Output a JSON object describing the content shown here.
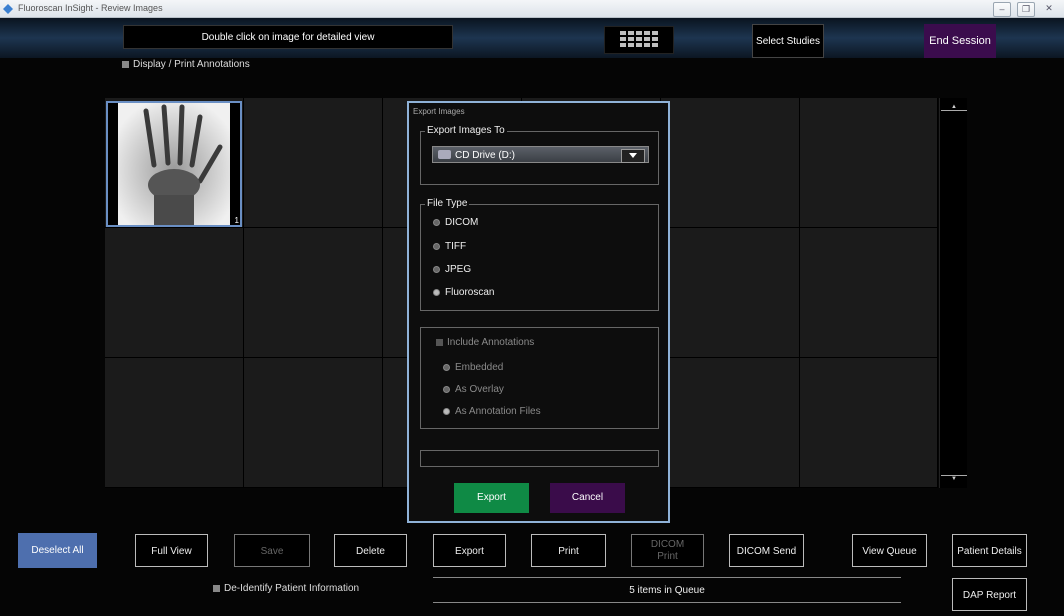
{
  "window": {
    "title": "Fluoroscan InSight - Review Images"
  },
  "header": {
    "hint": "Double click on image for detailed view",
    "select_studies": "Select Studies",
    "end_session": "End Session",
    "annotations_toggle": "Display / Print Annotations"
  },
  "viewer": {
    "thumbnail_index": "1"
  },
  "dialog": {
    "title": "Export Images",
    "export_to_legend": "Export Images To",
    "drive": "CD Drive (D:)",
    "file_type_legend": "File Type",
    "file_types": [
      {
        "label": "DICOM",
        "selected": false
      },
      {
        "label": "TIFF",
        "selected": false
      },
      {
        "label": "JPEG",
        "selected": false
      },
      {
        "label": "Fluoroscan",
        "selected": true
      }
    ],
    "include_annotations": "Include Annotations",
    "annotation_modes": [
      {
        "label": "Embedded",
        "selected": false
      },
      {
        "label": "As Overlay",
        "selected": false
      },
      {
        "label": "As Annotation Files",
        "selected": true
      }
    ],
    "export": "Export",
    "cancel": "Cancel"
  },
  "toolbar": {
    "deselect_all": "Deselect All",
    "full_view": "Full View",
    "save": "Save",
    "delete": "Delete",
    "export": "Export",
    "print": "Print",
    "dicom_print": "DICOM\nPrint",
    "dicom_send": "DICOM Send",
    "view_queue": "View Queue",
    "patient_details": "Patient Details",
    "dap_report": "DAP Report",
    "deidentify": "De-Identify Patient Information",
    "queue_status": "5 items in Queue"
  },
  "colors": {
    "accent_blue": "#4e6fae",
    "export_green": "#0f8a45",
    "purple": "#3b0c4d",
    "selection_border": "#6a8fc4"
  }
}
